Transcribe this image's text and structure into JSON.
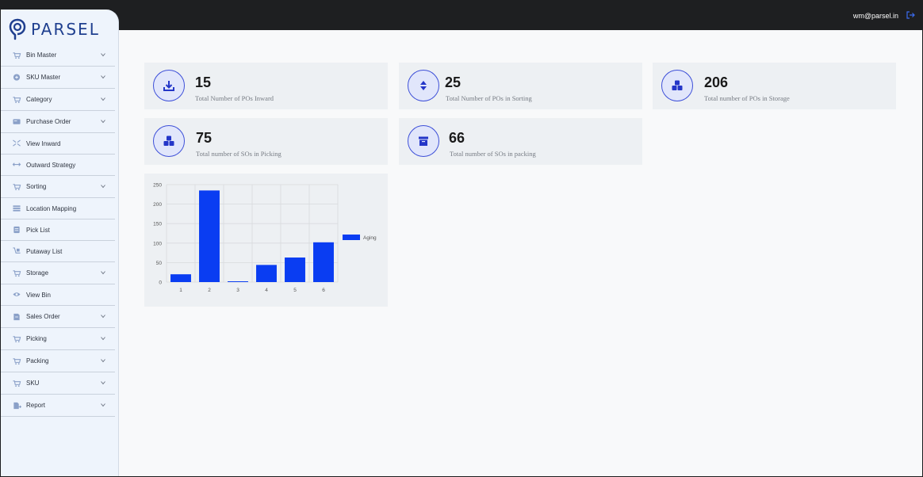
{
  "header": {
    "user_email": "wm@parsel.in",
    "logout_icon": "logout-icon"
  },
  "brand": {
    "name": "PARSEL",
    "logo_icon": "location-pin-logo",
    "color": "#1f3f8f"
  },
  "sidebar": {
    "items": [
      {
        "label": "Bin Master",
        "icon": "cart-icon",
        "has_chevron": true
      },
      {
        "label": "SKU Master",
        "icon": "plus-circle-icon",
        "has_chevron": true
      },
      {
        "label": "Category",
        "icon": "cart-icon",
        "has_chevron": true
      },
      {
        "label": "Purchase Order",
        "icon": "card-icon",
        "has_chevron": true
      },
      {
        "label": "View Inward",
        "icon": "arrows-in-icon",
        "has_chevron": false
      },
      {
        "label": "Outward Strategy",
        "icon": "arrows-horizontal-icon",
        "has_chevron": false
      },
      {
        "label": "Sorting",
        "icon": "cart-icon",
        "has_chevron": true
      },
      {
        "label": "Location Mapping",
        "icon": "layers-icon",
        "has_chevron": false
      },
      {
        "label": "Pick List",
        "icon": "clipboard-icon",
        "has_chevron": false
      },
      {
        "label": "Putaway List",
        "icon": "hand-truck-icon",
        "has_chevron": false
      },
      {
        "label": "Storage",
        "icon": "cart-icon",
        "has_chevron": true
      },
      {
        "label": "View Bin",
        "icon": "eye-icon",
        "has_chevron": false
      },
      {
        "label": "Sales Order",
        "icon": "document-icon",
        "has_chevron": true
      },
      {
        "label": "Picking",
        "icon": "cart-icon",
        "has_chevron": true
      },
      {
        "label": "Packing",
        "icon": "cart-icon",
        "has_chevron": true
      },
      {
        "label": "SKU",
        "icon": "cart-icon",
        "has_chevron": true
      },
      {
        "label": "Report",
        "icon": "report-icon",
        "has_chevron": true
      }
    ]
  },
  "stats": [
    {
      "value": "15",
      "label": "Total Number of POs Inward",
      "icon": "download-icon"
    },
    {
      "value": "25",
      "label": "Total Number of POs in Sorting",
      "icon": "sort-icon"
    },
    {
      "value": "206",
      "label": "Total number of POs in Storage",
      "icon": "boxes-icon"
    },
    {
      "value": "75",
      "label": "Total number of SOs in Picking",
      "icon": "boxes-icon"
    },
    {
      "value": "66",
      "label": "Total number of SOs in packing",
      "icon": "archive-icon"
    }
  ],
  "colors": {
    "accent": "#0a3df2",
    "icon_blue": "#2436c8",
    "circle_border": "#3d4fd8"
  },
  "chart_data": {
    "type": "bar",
    "categories": [
      "1",
      "2",
      "3",
      "4",
      "5",
      "6"
    ],
    "series": [
      {
        "name": "Aging",
        "values": [
          20,
          235,
          2,
          44,
          63,
          102
        ]
      }
    ],
    "ylim": [
      0,
      250
    ],
    "yticks": [
      "0",
      "50",
      "100",
      "150",
      "200",
      "250"
    ],
    "grid": true,
    "legend": "right",
    "color": "#0a3df2"
  }
}
